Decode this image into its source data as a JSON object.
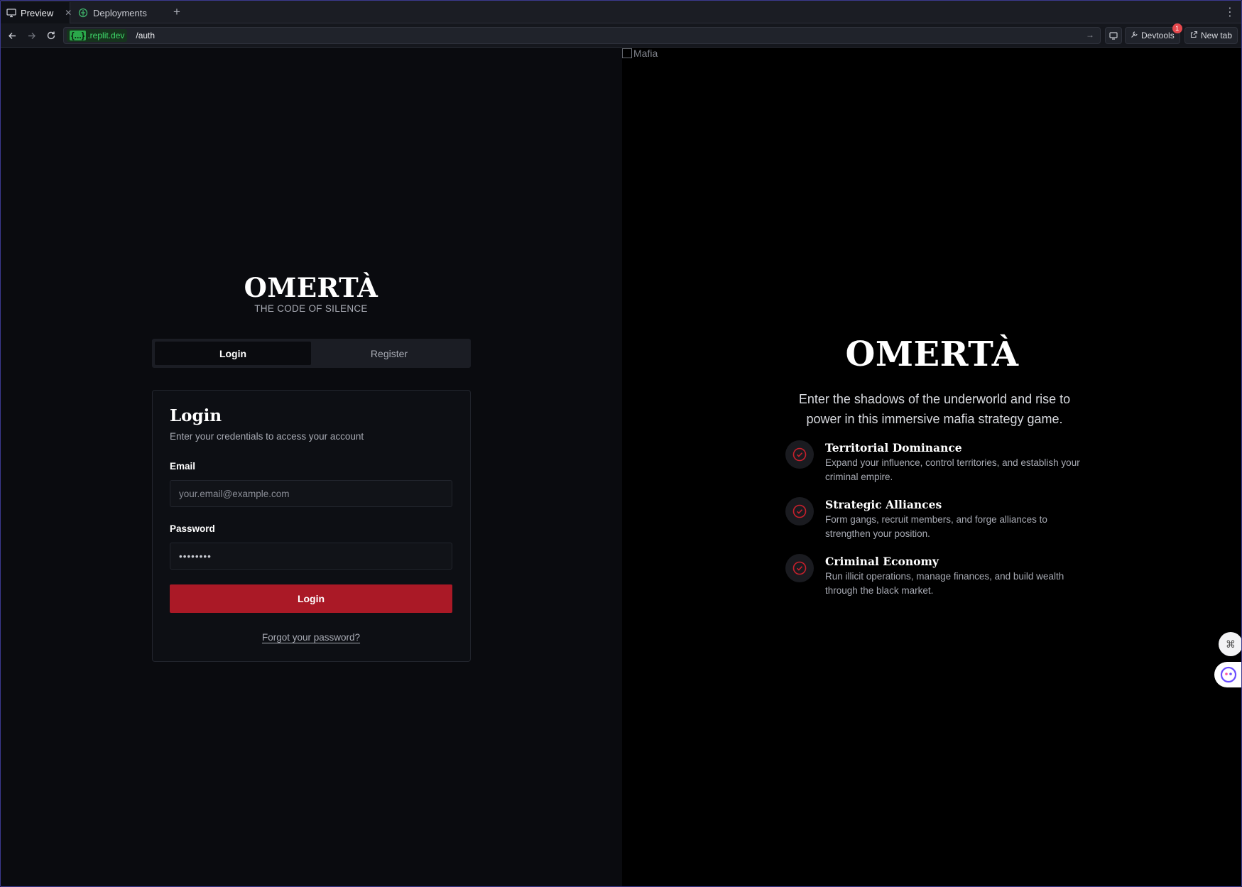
{
  "browser": {
    "tabs": [
      {
        "label": "Preview",
        "icon": "monitor-icon",
        "active": true
      },
      {
        "label": "Deployments",
        "icon": "deploy-icon",
        "active": false
      }
    ],
    "url_domain": ".replit.dev",
    "url_domain_prefix": "{...}",
    "url_path": "/auth",
    "devtools_label": "Devtools",
    "devtools_badge": "1",
    "new_tab_label": "New tab",
    "colors": {
      "domain_green": "#3fdc6b"
    }
  },
  "broken_image_alt": "Mafia",
  "left": {
    "brand": "OMERTÀ",
    "tagline": "THE CODE OF SILENCE",
    "tabs": [
      "Login",
      "Register"
    ],
    "selected_tab": "Login",
    "card": {
      "title": "Login",
      "subtitle": "Enter your credentials to access your account",
      "email_label": "Email",
      "email_placeholder": "your.email@example.com",
      "password_label": "Password",
      "password_value": "••••••••",
      "submit_label": "Login",
      "forgot_label": "Forgot your password?"
    }
  },
  "right": {
    "title": "OMERTÀ",
    "description": "Enter the shadows of the underworld and rise to power in this immersive mafia strategy game.",
    "features": [
      {
        "title": "Territorial Dominance",
        "description": "Expand your influence, control territories, and establish your criminal empire."
      },
      {
        "title": "Strategic Alliances",
        "description": "Form gangs, recruit members, and forge alliances to strengthen your position."
      },
      {
        "title": "Criminal Economy",
        "description": "Run illicit operations, manage finances, and build wealth through the black market."
      }
    ]
  },
  "colors": {
    "accent_red": "#aa1926",
    "check_red": "#c8202c",
    "background": "#0a0b0f"
  }
}
